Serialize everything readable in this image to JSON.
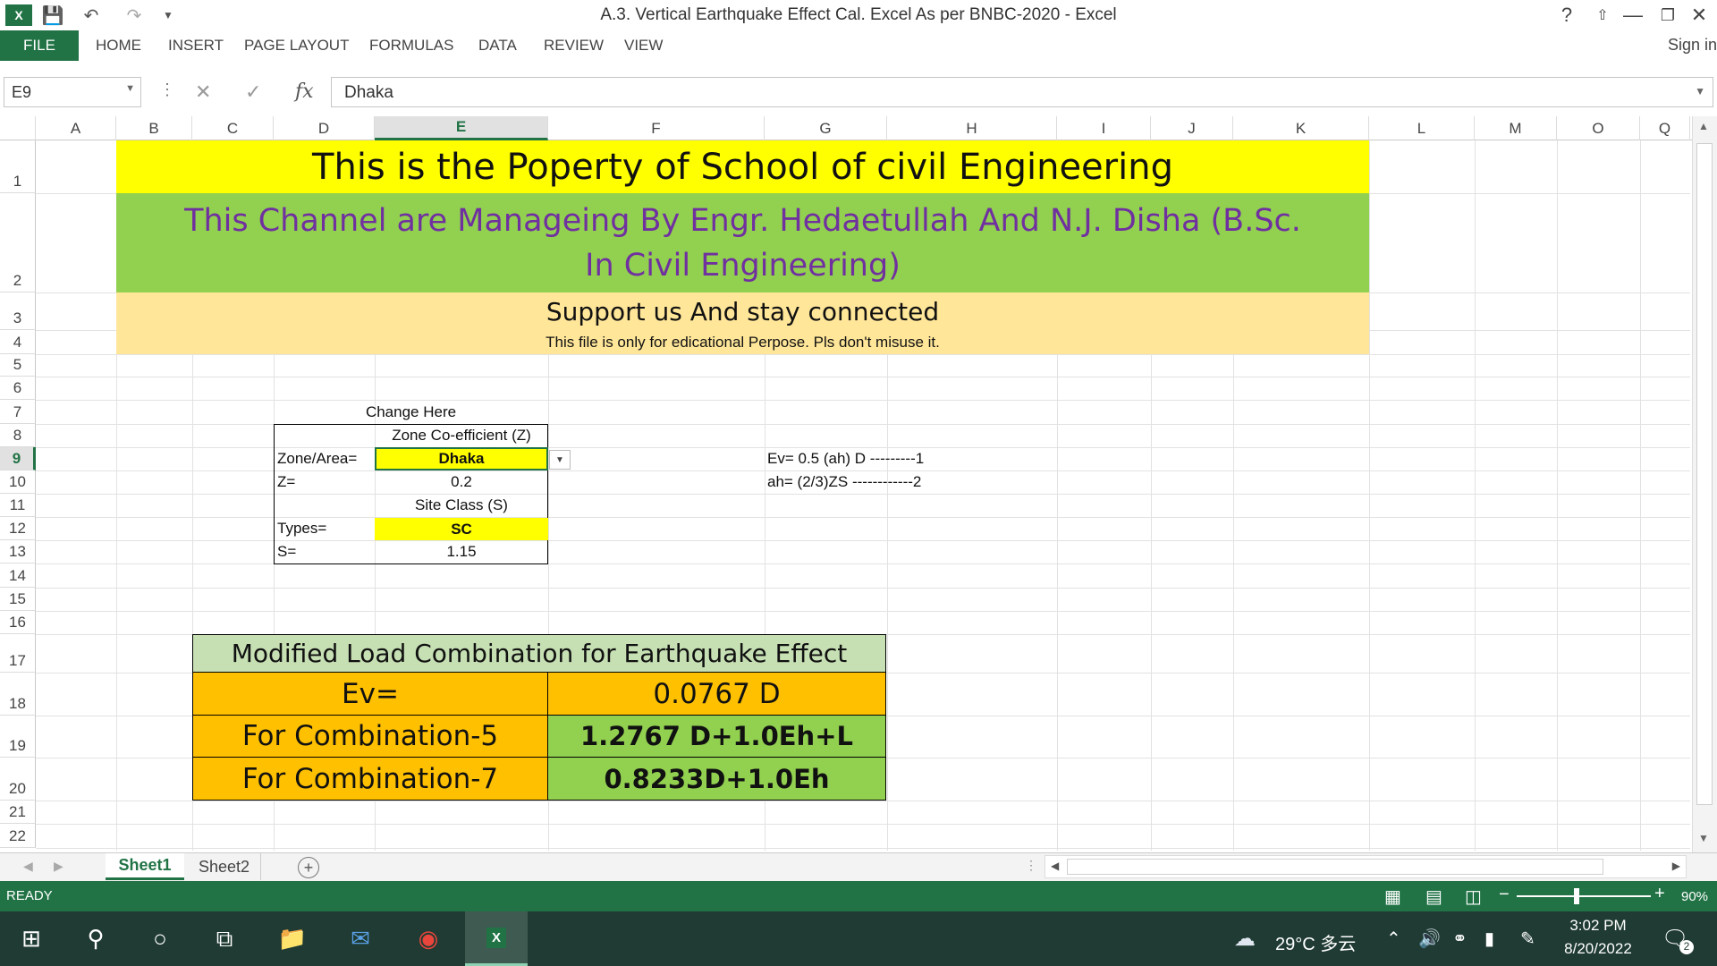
{
  "window": {
    "title": "A.3. Vertical Earthquake Effect Cal. Excel As per BNBC-2020 - Excel",
    "help": "?"
  },
  "ribbon": {
    "file": "FILE",
    "tabs": [
      "HOME",
      "INSERT",
      "PAGE LAYOUT",
      "FORMULAS",
      "DATA",
      "REVIEW",
      "VIEW"
    ],
    "sign_in": "Sign in"
  },
  "formula_bar": {
    "name_box": "E9",
    "fx": "fx",
    "value": "Dhaka"
  },
  "columns": [
    "A",
    "B",
    "C",
    "D",
    "E",
    "F",
    "G",
    "H",
    "I",
    "J",
    "K",
    "L",
    "M",
    "O",
    "Q"
  ],
  "rows": [
    "1",
    "2",
    "3",
    "4",
    "5",
    "6",
    "7",
    "8",
    "9",
    "10",
    "11",
    "12",
    "13",
    "14",
    "15",
    "16",
    "17",
    "18",
    "19",
    "20",
    "21",
    "22"
  ],
  "sheet": {
    "banner1": "This is the Poperty of School of civil Engineering",
    "banner2": "This Channel are Manageing By Engr. Hedaetullah And N.J. Disha (B.Sc. In Civil Engineering)",
    "banner3": "Support us And stay connected",
    "banner4": "This file is only for edicational Perpose. Pls don't misuse it.",
    "change_here": "Change Here",
    "zone_header": "Zone Co-efficient (Z)",
    "zone_label": "Zone/Area=",
    "zone_value": "Dhaka",
    "z_label": "Z=",
    "z_value": "0.2",
    "site_header": "Site Class (S)",
    "types_label": "Types=",
    "types_value": "SC",
    "s_label": "S=",
    "s_value": "1.15",
    "formula1": "Ev= 0.5 (ah) D ---------1",
    "formula2": "ah= (2/3)ZS ------------2",
    "result_title": "Modified Load Combination for Earthquake Effect",
    "ev_label": "Ev=",
    "ev_value": "0.0767 D",
    "combo5_label": "For Combination-5",
    "combo5_value": "1.2767 D+1.0Eh+L",
    "combo7_label": "For Combination-7",
    "combo7_value": "0.8233D+1.0Eh"
  },
  "sheet_tabs": [
    "Sheet1",
    "Sheet2"
  ],
  "status": {
    "ready": "READY",
    "zoom": "90%"
  },
  "taskbar": {
    "weather": "29°C 多云",
    "time": "3:02 PM",
    "date": "8/20/2022",
    "notifications": "2"
  },
  "colors": {
    "excel_green": "#217346",
    "yellow": "#ffff00",
    "green_band": "#92d050",
    "peach_band": "#ffe699",
    "orange": "#ffc000",
    "light_green": "#c6e0b4",
    "purple_text": "#7030a0"
  }
}
